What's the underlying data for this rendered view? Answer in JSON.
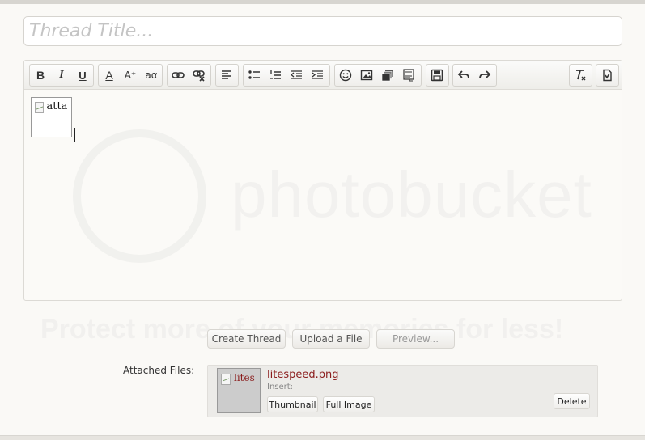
{
  "form": {
    "title_placeholder": "Thread Title..."
  },
  "toolbar": {
    "buttons": [
      {
        "name": "bold-button",
        "glyph": "B"
      },
      {
        "name": "italic-button",
        "glyph": "I"
      },
      {
        "name": "underline-button",
        "glyph": "U"
      },
      {
        "name": "font-color-button",
        "glyph": "A"
      },
      {
        "name": "font-size-button",
        "glyph": "A⁺"
      },
      {
        "name": "font-family-button",
        "glyph": "aα"
      }
    ]
  },
  "editor": {
    "image_alt": "atta"
  },
  "buttons": {
    "create_thread": "Create Thread",
    "upload_file": "Upload a File",
    "preview": "Preview..."
  },
  "attachments": {
    "label": "Attached Files:",
    "file": {
      "name": "litespeed.png",
      "thumb_alt": "lites",
      "insert_label": "Insert:",
      "thumbnail_button": "Thumbnail",
      "full_image_button": "Full Image",
      "delete_button": "Delete"
    }
  },
  "colors": {
    "file_link": "#8b1c1c",
    "background": "#faf9f6"
  }
}
